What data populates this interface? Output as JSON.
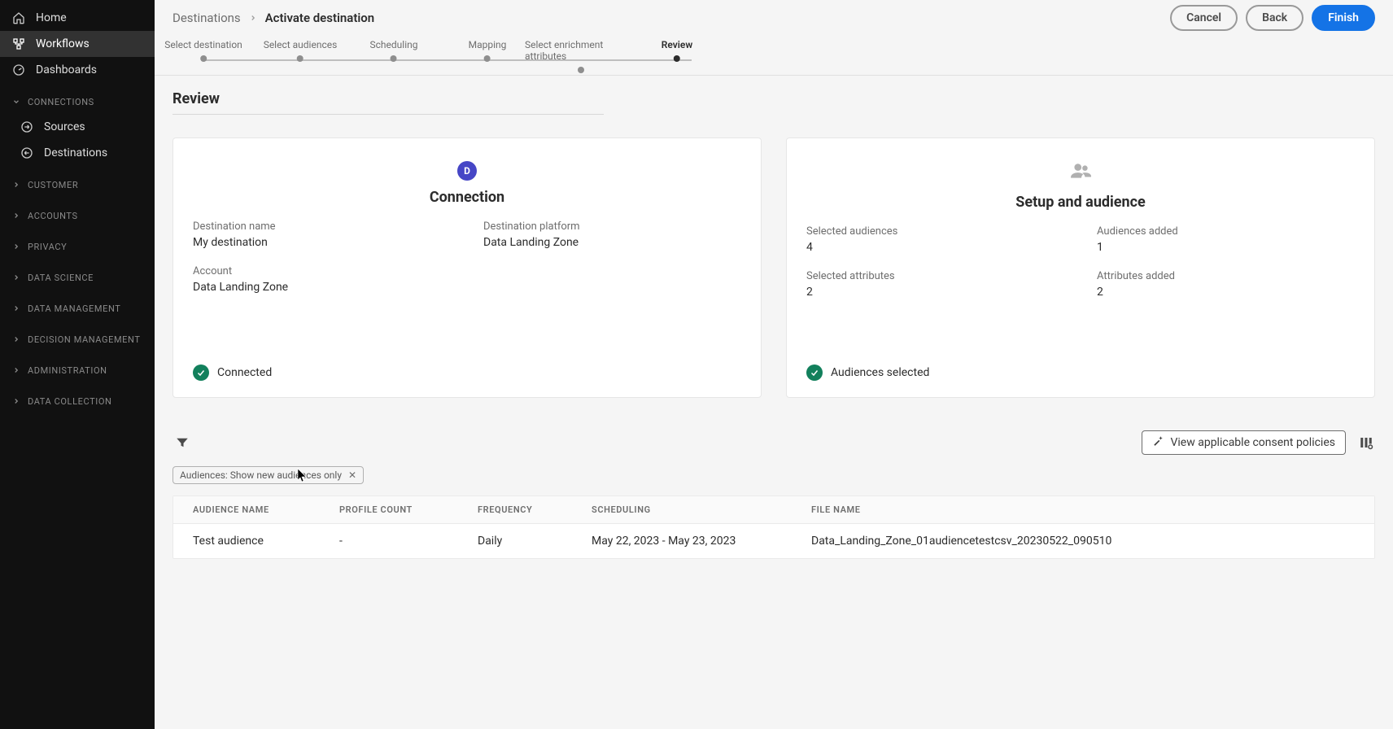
{
  "sidebar": {
    "items": [
      {
        "label": "Home",
        "icon": "home-icon"
      },
      {
        "label": "Workflows",
        "icon": "workflows-icon",
        "active": true
      },
      {
        "label": "Dashboards",
        "icon": "dashboards-icon"
      }
    ],
    "connections": {
      "label": "CONNECTIONS",
      "children": [
        {
          "label": "Sources",
          "icon": "sources-icon"
        },
        {
          "label": "Destinations",
          "icon": "destinations-icon"
        }
      ]
    },
    "collapsed_sections": [
      "CUSTOMER",
      "ACCOUNTS",
      "PRIVACY",
      "DATA SCIENCE",
      "DATA MANAGEMENT",
      "DECISION MANAGEMENT",
      "ADMINISTRATION",
      "DATA COLLECTION"
    ]
  },
  "breadcrumb": {
    "parent": "Destinations",
    "current": "Activate destination"
  },
  "actions": {
    "cancel": "Cancel",
    "back": "Back",
    "finish": "Finish"
  },
  "steps": [
    "Select destination",
    "Select audiences",
    "Scheduling",
    "Mapping",
    "Select enrichment attributes",
    "Review"
  ],
  "active_step_index": 5,
  "section_title": "Review",
  "connection_card": {
    "badge_letter": "D",
    "title": "Connection",
    "fields": {
      "destination_name_label": "Destination name",
      "destination_name_value": "My destination",
      "destination_platform_label": "Destination platform",
      "destination_platform_value": "Data Landing Zone",
      "account_label": "Account",
      "account_value": "Data Landing Zone"
    },
    "status": "Connected"
  },
  "setup_card": {
    "title": "Setup and audience",
    "fields": {
      "selected_audiences_label": "Selected audiences",
      "selected_audiences_value": "4",
      "audiences_added_label": "Audiences added",
      "audiences_added_value": "1",
      "selected_attributes_label": "Selected attributes",
      "selected_attributes_value": "2",
      "attributes_added_label": "Attributes added",
      "attributes_added_value": "2"
    },
    "status": "Audiences selected"
  },
  "filter_chip": "Audiences: Show new audiences only",
  "policy_button": "View applicable consent policies",
  "table": {
    "headers": {
      "name": "AUDIENCE NAME",
      "profile": "PROFILE COUNT",
      "frequency": "FREQUENCY",
      "scheduling": "SCHEDULING",
      "filename": "FILE NAME"
    },
    "rows": [
      {
        "name": "Test audience",
        "profile": "-",
        "frequency": "Daily",
        "scheduling": "May 22, 2023 - May 23, 2023",
        "filename": "Data_Landing_Zone_01audiencetestcsv_20230522_090510"
      }
    ]
  }
}
